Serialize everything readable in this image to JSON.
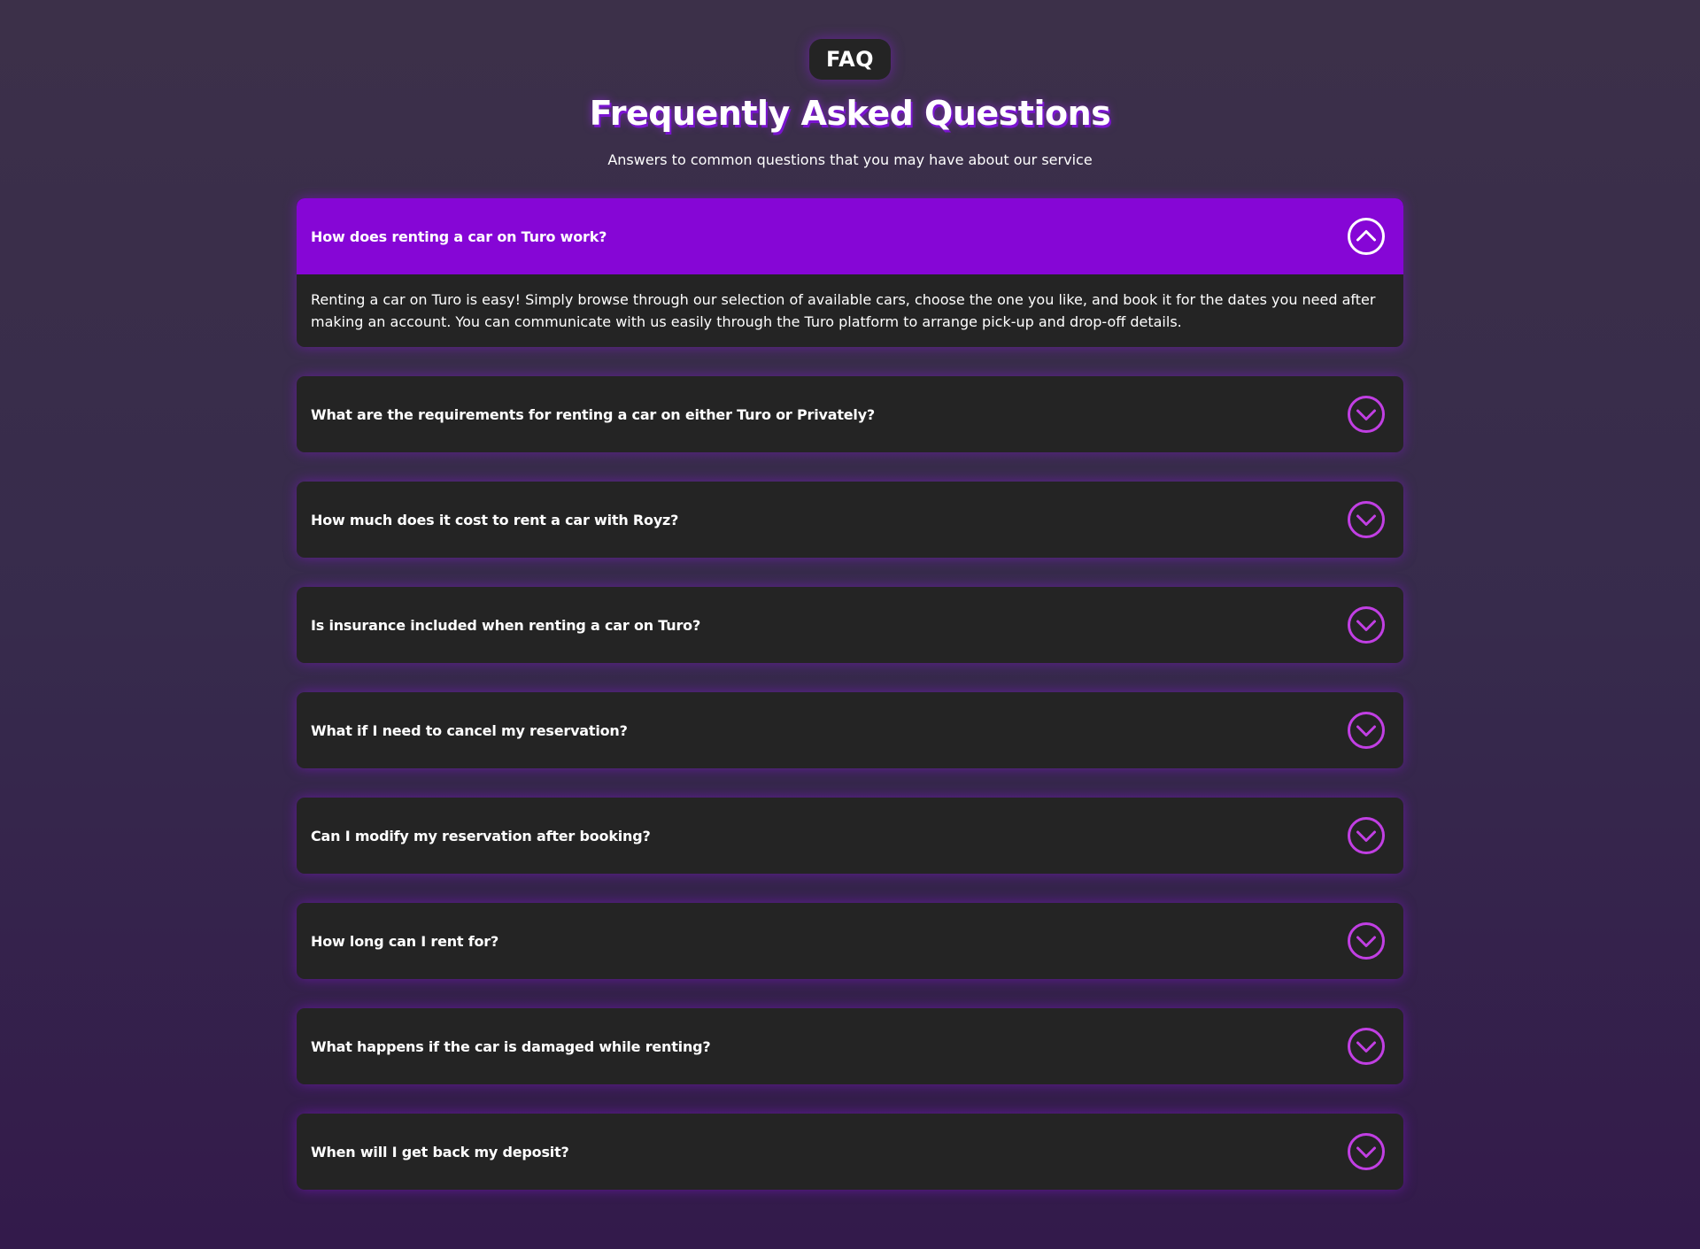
{
  "header": {
    "badge": "FAQ",
    "title": "Frequently Asked Questions",
    "subtitle": "Answers to common questions that you may have about our service"
  },
  "colors": {
    "accent": "#8606d6",
    "icon": "#c13fe3",
    "card": "#242424"
  },
  "faq": [
    {
      "question": "How does renting a car on Turo work?",
      "answer": "Renting a car on Turo is easy! Simply browse through our selection of available cars, choose the one you like, and book it for the dates you need after making an account. You can communicate with us easily through the Turo platform to arrange pick-up and drop-off details.",
      "open": true,
      "icon": "chevron-up-circle-icon"
    },
    {
      "question": "What are the requirements for renting a car on either Turo or Privately?",
      "open": false,
      "icon": "chevron-down-circle-icon"
    },
    {
      "question": "How much does it cost to rent a car with Royz?",
      "open": false,
      "icon": "chevron-down-circle-icon"
    },
    {
      "question": "Is insurance included when renting a car on Turo?",
      "open": false,
      "icon": "chevron-down-circle-icon"
    },
    {
      "question": "What if I need to cancel my reservation?",
      "open": false,
      "icon": "chevron-down-circle-icon"
    },
    {
      "question": "Can I modify my reservation after booking?",
      "open": false,
      "icon": "chevron-down-circle-icon"
    },
    {
      "question": "How long can I rent for?",
      "open": false,
      "icon": "chevron-down-circle-icon"
    },
    {
      "question": "What happens if the car is damaged while renting?",
      "open": false,
      "icon": "chevron-down-circle-icon"
    },
    {
      "question": "When will I get back my deposit?",
      "open": false,
      "icon": "chevron-down-circle-icon"
    }
  ]
}
